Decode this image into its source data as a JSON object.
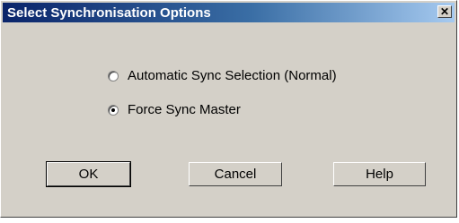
{
  "window": {
    "title": "Select Synchronisation Options",
    "close_icon": "close-icon"
  },
  "options": [
    {
      "label": "Automatic Sync Selection (Normal)",
      "selected": false
    },
    {
      "label": "Force Sync Master",
      "selected": true
    }
  ],
  "buttons": {
    "ok": "OK",
    "cancel": "Cancel",
    "help": "Help"
  }
}
